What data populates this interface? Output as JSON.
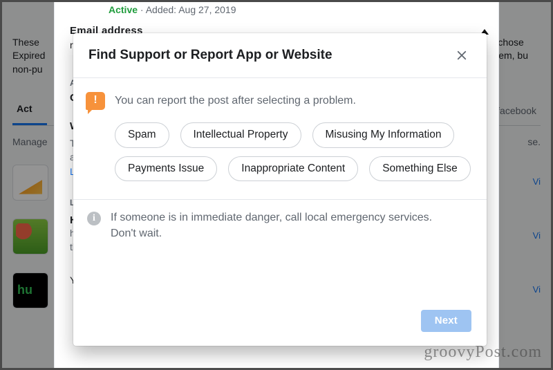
{
  "background": {
    "status_label": "Active",
    "added_label": "· Added: Aug 27, 2019",
    "desc_line1": "These",
    "desc_line2": "Expired",
    "desc_line3": "non-pu",
    "desc_right1": "you chose",
    "desc_right2": "th them, bu",
    "tab_active": "Act",
    "tab_right": "facebook",
    "manage": "Manage",
    "view_edit": "Vi",
    "hulu_thumb_text": "hu"
  },
  "under_modal": {
    "status": "Active",
    "added": "· Added: Aug 27, 2019",
    "email_heading": "Email address",
    "email_value": "ryj",
    "section_ad": "AD",
    "ca_label": "Ca",
    "section_w": "W",
    "w_line1": "Th",
    "w_line2": "ap",
    "learn_more": "Le",
    "section_le": "LE",
    "hu1": "Hu",
    "hu2": "ho",
    "hu3": "thi",
    "yo": "Yo",
    "se_right": "se."
  },
  "dialog": {
    "title": "Find Support or Report App or Website",
    "prompt": "You can report the post after selecting a problem.",
    "chips": [
      "Spam",
      "Intellectual Property",
      "Misusing My Information",
      "Payments Issue",
      "Inappropriate Content",
      "Something Else"
    ],
    "emergency": "If someone is in immediate danger, call local emergency services. Don't wait.",
    "next": "Next"
  },
  "watermark": "groovyPost.com"
}
